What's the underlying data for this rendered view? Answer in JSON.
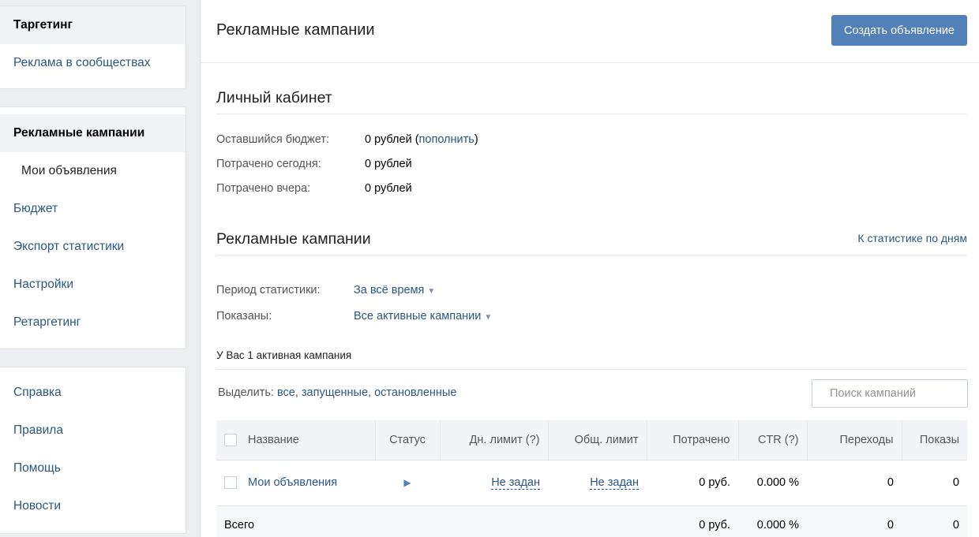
{
  "sidebar": {
    "group1": [
      "Таргетинг",
      "Реклама в сообществах"
    ],
    "group2": [
      "Рекламные кампании",
      "Мои объявления",
      "Бюджет",
      "Экспорт статистики",
      "Настройки",
      "Ретаргетинг"
    ],
    "group3": [
      "Справка",
      "Правила",
      "Помощь",
      "Новости"
    ]
  },
  "header": {
    "title": "Рекламные кампании",
    "create_button": "Создать объявление"
  },
  "cabinet": {
    "title": "Личный кабинет",
    "budget_label": "Оставшийся бюджет:",
    "budget_value": "0 рублей",
    "budget_link": "пополнить",
    "today_label": "Потрачено сегодня:",
    "today_value": "0 рублей",
    "yesterday_label": "Потрачено вчера:",
    "yesterday_value": "0 рублей"
  },
  "campaigns": {
    "title": "Рекламные кампании",
    "stats_link": "К статистике по дням",
    "period_label": "Период статистики:",
    "period_value": "За всё время",
    "shown_label": "Показаны:",
    "shown_value": "Все активные кампании",
    "note": "У Вас 1 активная кампания",
    "select_prefix": "Выделить:",
    "select_all": "все",
    "select_running": "запущенные",
    "select_stopped": "остановленные",
    "search_placeholder": "Поиск кампаний"
  },
  "table": {
    "headers": [
      "Название",
      "Статус",
      "Дн. лимит (?)",
      "Общ. лимит",
      "Потрачено",
      "CTR (?)",
      "Переходы",
      "Показы"
    ],
    "rows": [
      {
        "name": "Мои объявления",
        "day_limit": "Не задан",
        "total_limit": "Не задан",
        "spent": "0 руб.",
        "ctr": "0.000 %",
        "clicks": "0",
        "views": "0"
      }
    ],
    "total": {
      "label": "Всего",
      "spent": "0 руб.",
      "ctr": "0.000 %",
      "clicks": "0",
      "views": "0"
    }
  }
}
